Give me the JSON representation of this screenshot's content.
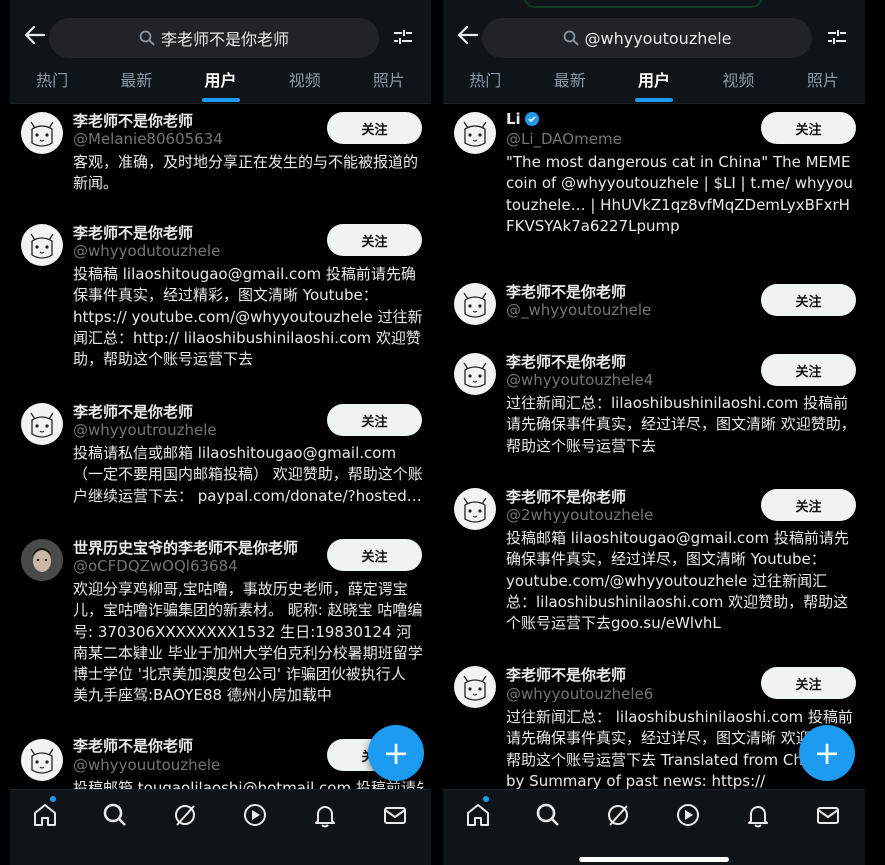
{
  "theme": {
    "accent": "#1d9bf0",
    "bg": "#000000",
    "bar": "#0f1419",
    "muted": "#71767b"
  },
  "left": {
    "search_query": "李老师不是你老师",
    "tabs": [
      "热门",
      "最新",
      "用户",
      "视频",
      "照片"
    ],
    "active_tab": "用户",
    "users": [
      {
        "name": "李老师不是你老师",
        "handle": "@Melanie80605634",
        "bio": "客观，准确，及时地分享正在发生的与不能被报道的新闻。",
        "follow": "关注"
      },
      {
        "name": "李老师不是你老师",
        "handle": "@whyyodutouzhele",
        "bio": "投稿稿 lilaoshitougao@gmail.com 投稿前请先确保事件真实，经过精彩，图文清晰 Youtube：https:// youtube.com/@whyyoutouzhele 过往新闻汇总：http:// lilaoshibushinilaoshi.com 欢迎赞助，帮助这个账号运营下去",
        "follow": "关注"
      },
      {
        "name": "李老师不是你老师",
        "handle": "@whyyoutrouzhele",
        "bio": "投稿请私信或邮箱 lilaoshitougao@gmail.com （一定不要用国内邮箱投稿） 欢迎赞助，帮助这个账户继续运营下去： paypal.com/donate/?hosted…",
        "follow": "关注"
      },
      {
        "name": "世界历史宝爷的李老师不是你老师",
        "handle": "@oCFDQZwOQl63684",
        "bio": "欢迎分享鸡柳哥,宝咕噜，事故历史老师，薛定谔宝儿，宝咕噜诈骗集团的新素材。 昵称: 赵晓宝 咕噜编号: 370306XXXXXXXX1532 生日:19830124 河南某二本肄业 毕业于加州大学伯克利分校暑期班留学博士学位 '北京美加澳皮包公司' 诈骗团伙被执行人 美九手座驾:BAOYE88 德州小房加载中",
        "follow": "关注"
      },
      {
        "name": "李老师不是你老师",
        "handle": "@whyyouutouzhele",
        "bio": "投稿邮箱 tougaolilaoshi@hotmail.com 投稿前请先",
        "follow": "关注"
      }
    ],
    "fab": "+"
  },
  "right": {
    "search_query": "@whyyoutouzhele",
    "tabs": [
      "热门",
      "最新",
      "用户",
      "视频",
      "照片"
    ],
    "active_tab": "用户",
    "users": [
      {
        "name": "Li",
        "handle": "@Li_DAOmeme",
        "bio": "\"The most dangerous cat in China\" The MEME coin of @whyyoutouzhele | $LI | t.me/ whyyoutouzhele… | HhUVkZ1qz8vfMqZDemLyxBFxrHFKVSYAk7a6227Lpump",
        "follow": "关注"
      },
      {
        "name": "李老师不是你老师",
        "handle": "@_whyyoutouzhele",
        "bio": "",
        "follow": "关注"
      },
      {
        "name": "李老师不是你老师",
        "handle": "@whyyoutouzhele4",
        "bio": "过往新闻汇总：lilaoshibushinilaoshi.com 投稿前请先确保事件真实，经过详尽，图文清晰 欢迎赞助，帮助这个账号运营下去",
        "follow": "关注"
      },
      {
        "name": "李老师不是你老师",
        "handle": "@2whyyoutouzhele",
        "bio": "投稿邮箱 lilaoshitougao@gmail.com 投稿前请先确保事件真实，经过详尽，图文清晰 Youtube：youtube.com/@whyyoutouzhele 过往新闻汇总：lilaoshibushinilaoshi.com 欢迎赞助，帮助这个账号运营下去goo.su/eWlvhL",
        "follow": "关注"
      },
      {
        "name": "李老师不是你老师",
        "handle": "@whyyoutouzhele6",
        "bio": "过往新闻汇总： lilaoshibushinilaoshi.com 投稿前请先确保事件真实，经过详尽，图文清晰 欢迎赞助，帮助这个账号运营下去 Translated from Chinese by Summary of past news: https://",
        "follow": "关注"
      }
    ],
    "fab": "+"
  },
  "icons": [
    "back-arrow-icon",
    "search-icon",
    "filter-icon",
    "home-icon",
    "explore-icon",
    "grok-icon",
    "video-icon",
    "bell-icon",
    "mail-icon",
    "verified-badge-icon",
    "plus-icon"
  ]
}
